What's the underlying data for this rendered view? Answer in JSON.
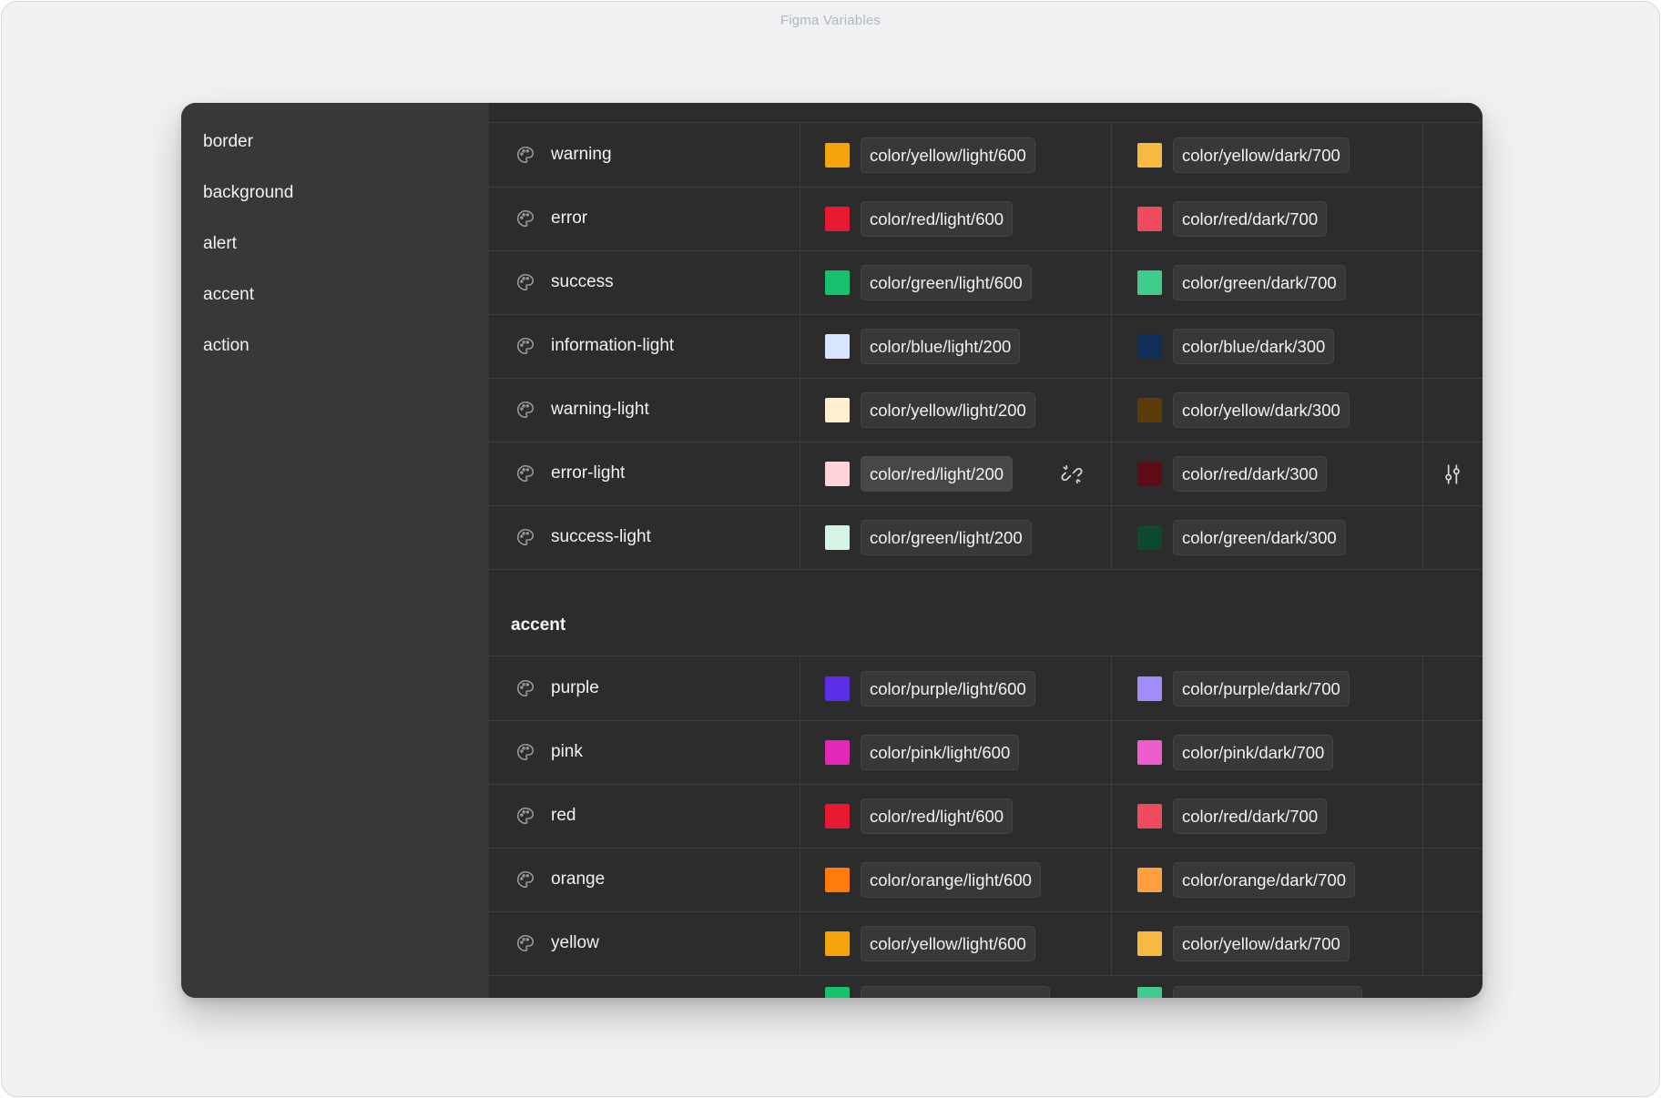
{
  "window": {
    "title": "Figma Variables"
  },
  "sidebar": {
    "items": [
      {
        "label": "border"
      },
      {
        "label": "background"
      },
      {
        "label": "alert"
      },
      {
        "label": "accent"
      },
      {
        "label": "action"
      }
    ]
  },
  "alert_rows": [
    {
      "name": "warning",
      "light": {
        "color": "#F5A30B",
        "ref": "color/yellow/light/600"
      },
      "dark": {
        "color": "#F8B940",
        "ref": "color/yellow/dark/700"
      }
    },
    {
      "name": "error",
      "light": {
        "color": "#E5192F",
        "ref": "color/red/light/600"
      },
      "dark": {
        "color": "#EC4C5B",
        "ref": "color/red/dark/700"
      }
    },
    {
      "name": "success",
      "light": {
        "color": "#17C16D",
        "ref": "color/green/light/600"
      },
      "dark": {
        "color": "#3FCC8C",
        "ref": "color/green/dark/700"
      }
    },
    {
      "name": "information-light",
      "light": {
        "color": "#D8E6FF",
        "ref": "color/blue/light/200"
      },
      "dark": {
        "color": "#0F2E5A",
        "ref": "color/blue/dark/300"
      }
    },
    {
      "name": "warning-light",
      "light": {
        "color": "#FFF0D2",
        "ref": "color/yellow/light/200"
      },
      "dark": {
        "color": "#5C3D0A",
        "ref": "color/yellow/dark/300"
      }
    },
    {
      "name": "error-light",
      "light": {
        "color": "#FFD3DA",
        "ref": "color/red/light/200"
      },
      "dark": {
        "color": "#5E0C18",
        "ref": "color/red/dark/300"
      }
    },
    {
      "name": "success-light",
      "light": {
        "color": "#D5F4E6",
        "ref": "color/green/light/200"
      },
      "dark": {
        "color": "#0B4A2C",
        "ref": "color/green/dark/300"
      }
    }
  ],
  "accent_group": {
    "title": "accent"
  },
  "accent_rows": [
    {
      "name": "purple",
      "light": {
        "color": "#5B2DE6",
        "ref": "color/purple/light/600"
      },
      "dark": {
        "color": "#A28BFA",
        "ref": "color/purple/dark/700"
      }
    },
    {
      "name": "pink",
      "light": {
        "color": "#E228B8",
        "ref": "color/pink/light/600"
      },
      "dark": {
        "color": "#EE5CCE",
        "ref": "color/pink/dark/700"
      }
    },
    {
      "name": "red",
      "light": {
        "color": "#E5192F",
        "ref": "color/red/light/600"
      },
      "dark": {
        "color": "#EC4C5B",
        "ref": "color/red/dark/700"
      }
    },
    {
      "name": "orange",
      "light": {
        "color": "#FF7C0A",
        "ref": "color/orange/light/600"
      },
      "dark": {
        "color": "#FFA03C",
        "ref": "color/orange/dark/700"
      }
    },
    {
      "name": "yellow",
      "light": {
        "color": "#F5A30B",
        "ref": "color/yellow/light/600"
      },
      "dark": {
        "color": "#F8B940",
        "ref": "color/yellow/dark/700"
      }
    }
  ],
  "partial_bottom": {
    "light_color": "#17C16D",
    "dark_color": "#3FCC8C"
  },
  "icons": {
    "row_icon": "palette-icon",
    "unlink": "unlink-icon",
    "settings": "sliders-icon"
  }
}
